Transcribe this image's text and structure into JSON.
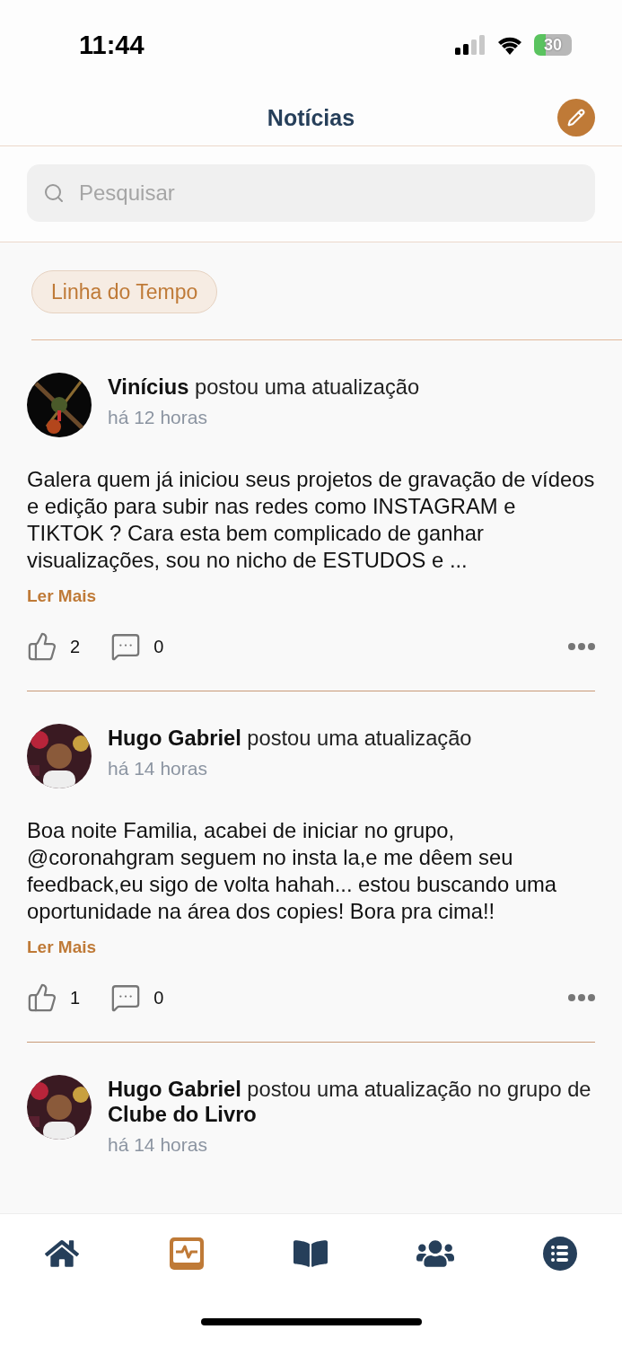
{
  "status_bar": {
    "time": "11:44",
    "battery": "30"
  },
  "header": {
    "title": "Notícias"
  },
  "search": {
    "placeholder": "Pesquisar"
  },
  "filter": {
    "label": "Linha do Tempo",
    "selected": true
  },
  "posts": [
    {
      "author_line": "**Vinícius** postou uma atualização",
      "time": "há 12 horas",
      "body": "Galera quem já iniciou seus projetos de gravação de vídeos e edição para subir nas redes como INSTAGRAM e TIKTOK ? Cara esta bem complicado de ganhar visualizações, sou no nicho de ESTUDOS e ...",
      "read_more": "Ler Mais",
      "likes": "2",
      "comments": "0"
    },
    {
      "author_line": "**Hugo Gabriel** postou uma atualização",
      "time": "há 14 horas",
      "body": "Boa noite Familia, acabei de iniciar no grupo, @coronahgram seguem no insta la,e me dêem seu feedback,eu sigo de volta hahah... estou buscando uma oportunidade na área dos copies! Bora pra cima!!",
      "read_more": "Ler Mais",
      "likes": "1",
      "comments": "0"
    },
    {
      "author_line": "**Hugo Gabriel** postou uma atualização no grupo de **Clube do Livro**",
      "time": "há 14 horas"
    }
  ],
  "tab_bar": [
    {
      "kind": "home",
      "selected": false
    },
    {
      "kind": "activity",
      "selected": true
    },
    {
      "kind": "book",
      "selected": false
    },
    {
      "kind": "groups",
      "selected": false
    },
    {
      "kind": "list",
      "selected": false
    }
  ]
}
